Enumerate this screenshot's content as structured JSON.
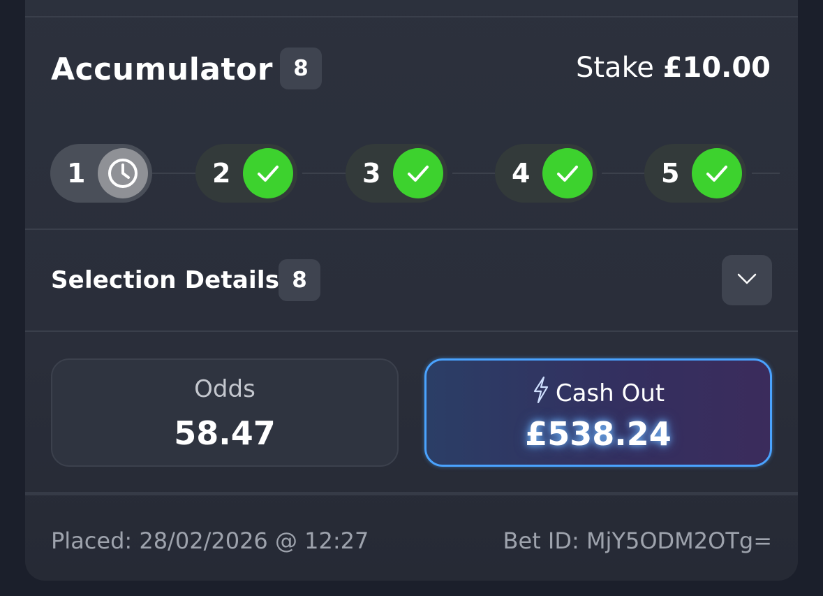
{
  "bet": {
    "type_label": "Accumulator",
    "leg_count": "8",
    "stake_label": "Stake",
    "stake_amount": "£10.00"
  },
  "legs": [
    {
      "number": "1",
      "status": "pending",
      "icon": "clock-icon"
    },
    {
      "number": "2",
      "status": "won",
      "icon": "check-icon"
    },
    {
      "number": "3",
      "status": "won",
      "icon": "check-icon"
    },
    {
      "number": "4",
      "status": "won",
      "icon": "check-icon"
    },
    {
      "number": "5",
      "status": "won",
      "icon": "check-icon"
    }
  ],
  "selection": {
    "title": "Selection Details",
    "count": "8",
    "toggle_icon": "chevron-down-icon"
  },
  "odds": {
    "label": "Odds",
    "value": "58.47"
  },
  "cashout": {
    "label": "Cash Out",
    "icon": "lightning-icon",
    "value": "£538.24"
  },
  "footer": {
    "placed": "Placed: 28/02/2026 @ 12:27",
    "bet_id": "Bet ID: MjY5ODM2OTg="
  },
  "colors": {
    "won": "#3dd22e",
    "pending": "#8f9196",
    "cashout_border": "#4aa3ff",
    "background": "#1b1f2b",
    "card": "#2c313d"
  }
}
